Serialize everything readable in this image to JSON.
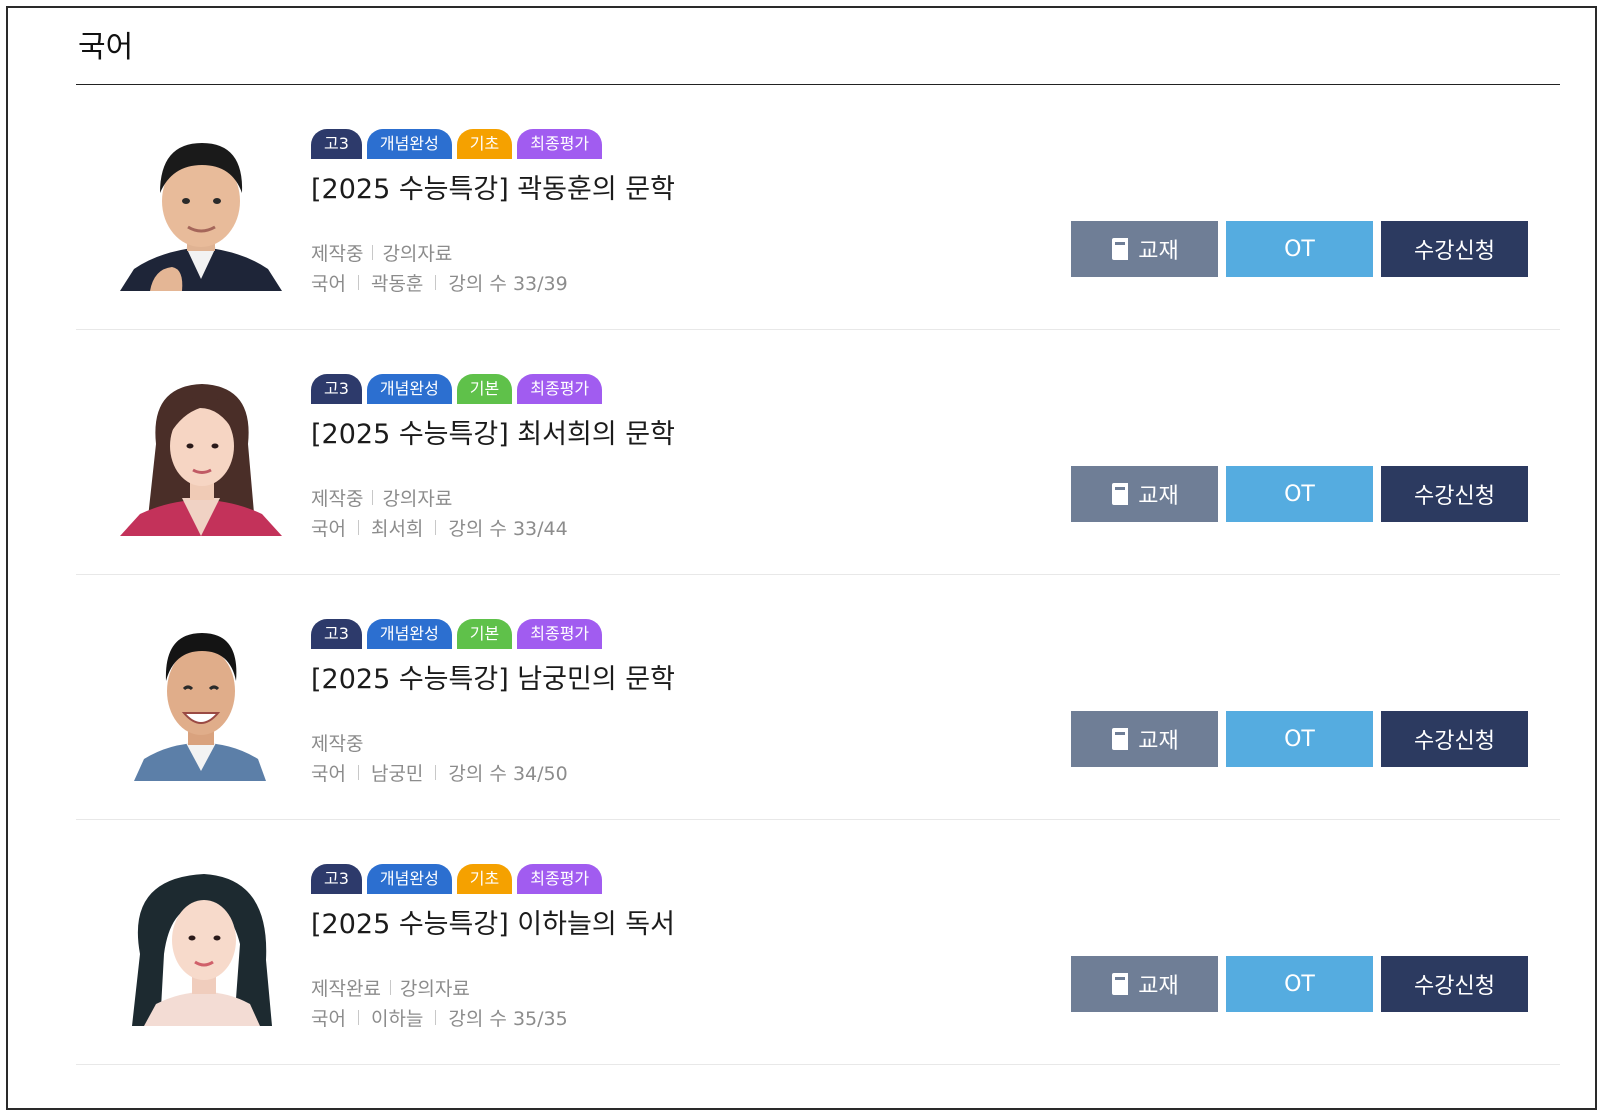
{
  "section": {
    "title": "국어"
  },
  "colors": {
    "tag_grade": "#2d3a6b",
    "tag_concept": "#2c6fd0",
    "tag_basic_orange": "#f5a100",
    "tag_basic_green": "#5fc14a",
    "tag_final": "#a15cf0",
    "btn_book": "#6f7e96",
    "btn_ot": "#55ace0",
    "btn_enroll": "#2c3a60"
  },
  "courses": [
    {
      "tags": [
        "고3",
        "개념완성",
        "기초",
        "최종평가"
      ],
      "title": "[2025 수능특강] 곽동훈의 문학",
      "status": "제작중",
      "material": "강의자료",
      "subject": "국어",
      "teacher": "곽동훈",
      "lecture_count": "강의 수 33/39",
      "buttons": {
        "book": "교재",
        "ot": "OT",
        "enroll": "수강신청"
      }
    },
    {
      "tags": [
        "고3",
        "개념완성",
        "기본",
        "최종평가"
      ],
      "title": "[2025 수능특강] 최서희의 문학",
      "status": "제작중",
      "material": "강의자료",
      "subject": "국어",
      "teacher": "최서희",
      "lecture_count": "강의 수 33/44",
      "buttons": {
        "book": "교재",
        "ot": "OT",
        "enroll": "수강신청"
      }
    },
    {
      "tags": [
        "고3",
        "개념완성",
        "기본",
        "최종평가"
      ],
      "title": "[2025 수능특강] 남궁민의 문학",
      "status": "제작중",
      "material": "",
      "subject": "국어",
      "teacher": "남궁민",
      "lecture_count": "강의 수 34/50",
      "buttons": {
        "book": "교재",
        "ot": "OT",
        "enroll": "수강신청"
      }
    },
    {
      "tags": [
        "고3",
        "개념완성",
        "기초",
        "최종평가"
      ],
      "title": "[2025 수능특강] 이하늘의 독서",
      "status": "제작완료",
      "material": "강의자료",
      "subject": "국어",
      "teacher": "이하늘",
      "lecture_count": "강의 수 35/35",
      "buttons": {
        "book": "교재",
        "ot": "OT",
        "enroll": "수강신청"
      }
    }
  ]
}
